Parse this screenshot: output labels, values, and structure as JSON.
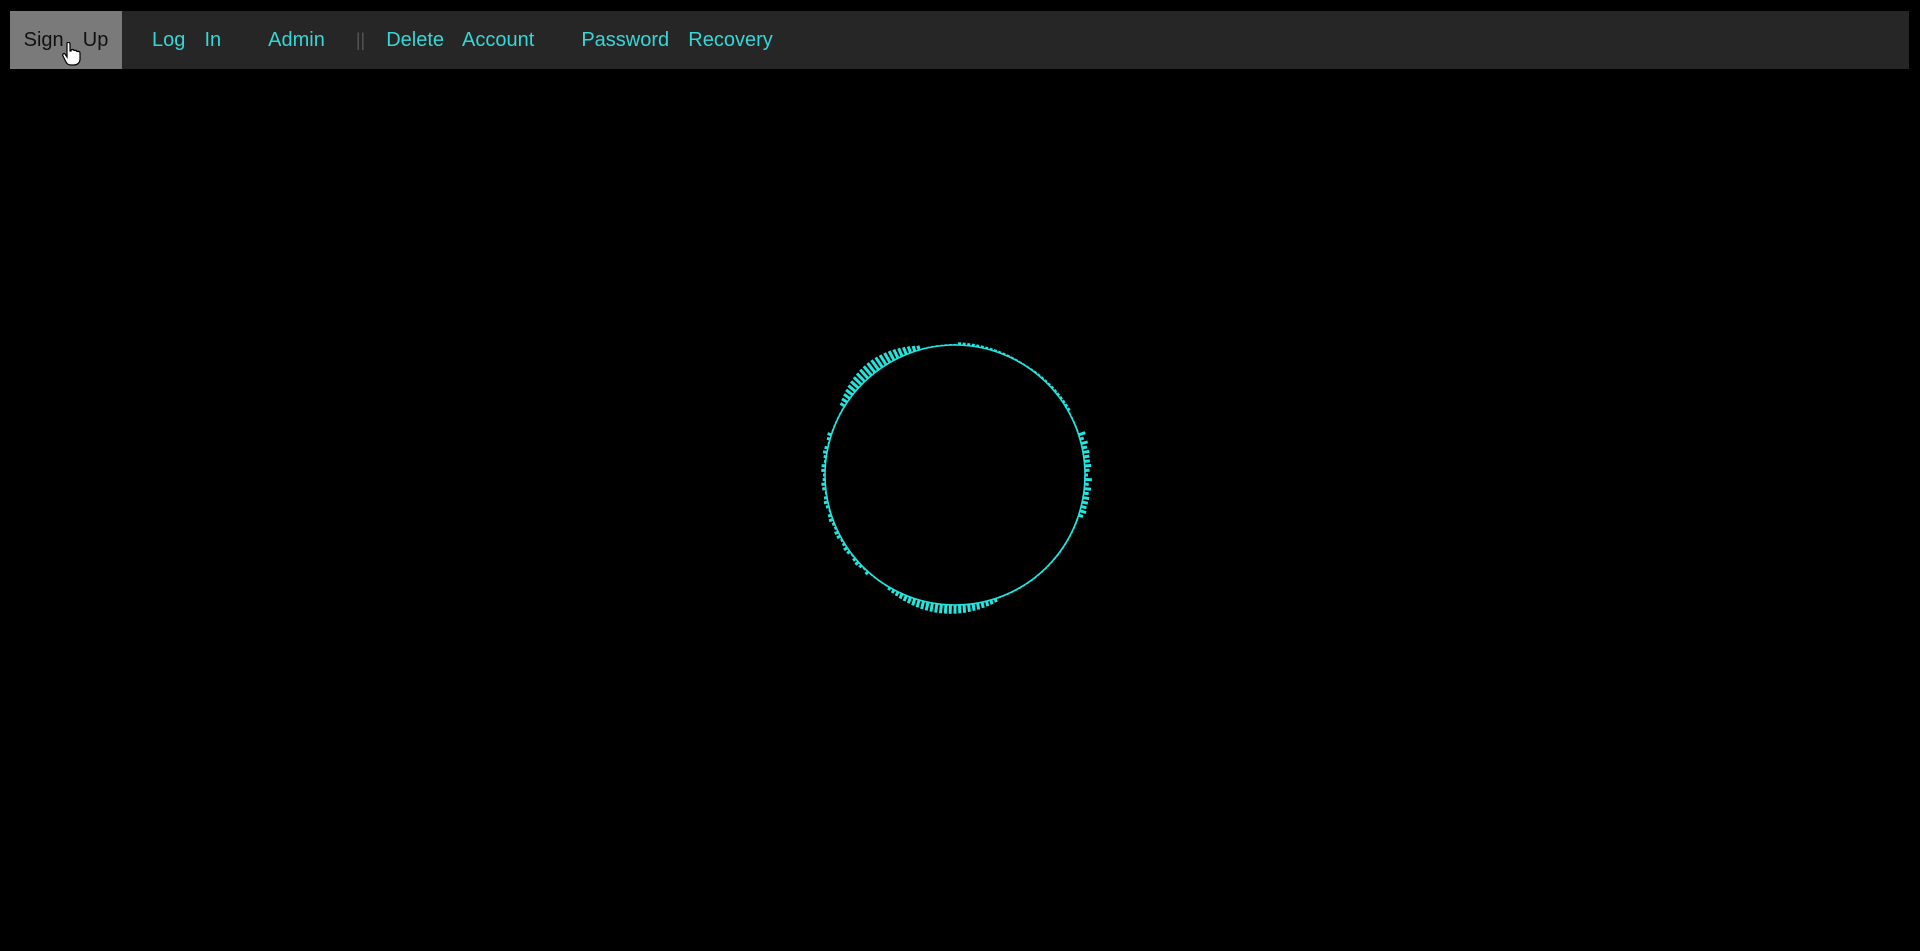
{
  "nav": {
    "items": [
      {
        "label": "Sign  Up",
        "active": true
      },
      {
        "label": "Log  In"
      },
      {
        "label": "Admin"
      },
      {
        "label": "Delete  Account"
      },
      {
        "label": "Password  Recovery"
      }
    ],
    "separator": "||"
  },
  "colors": {
    "background": "#000000",
    "navbar": "#262626",
    "active_item_bg": "#7a7a7a",
    "link": "#36d6d6",
    "visualizer": "#20e6e0"
  },
  "icons": {
    "cursor": "hand-pointer-icon"
  }
}
